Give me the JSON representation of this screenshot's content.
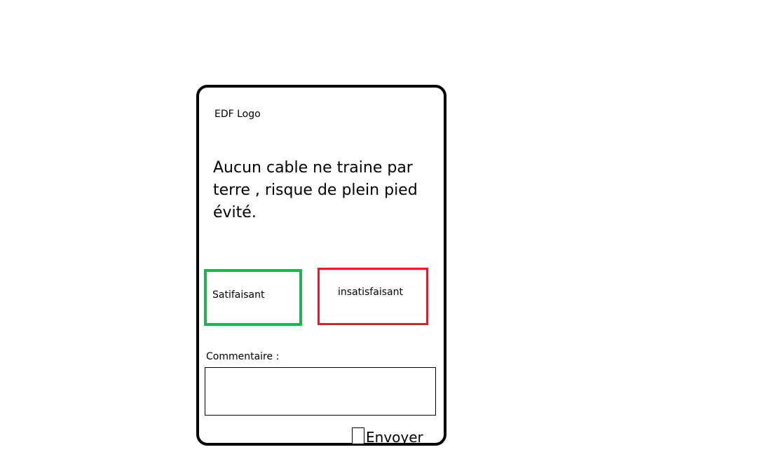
{
  "card": {
    "logo_text": "EDF Logo",
    "question": "Aucun cable ne traine par terre , risque de plein pied évité.",
    "answers": {
      "positive_label": "Satifaisant",
      "negative_label": "insatisfaisant"
    },
    "comment": {
      "label": "Commentaire :",
      "value": ""
    },
    "submit": {
      "checked": false,
      "label": "Envoyer"
    }
  },
  "colors": {
    "positive": "#22b14c",
    "negative": "#ed1c24",
    "border": "#000000",
    "background": "#ffffff"
  }
}
